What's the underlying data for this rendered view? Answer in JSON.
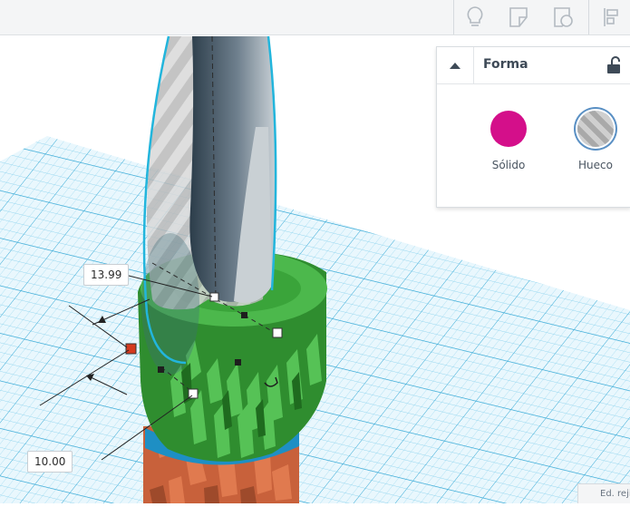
{
  "toolbar": {
    "buttons": [
      {
        "name": "lightbulb-icon"
      },
      {
        "name": "notes-icon"
      },
      {
        "name": "shape-notes-icon"
      },
      {
        "name": "align-icon"
      }
    ]
  },
  "shape_panel": {
    "title": "Forma",
    "options": [
      {
        "label": "Sólido",
        "color": "#d40f8a",
        "selected": true
      },
      {
        "label": "Hueco",
        "color": "#b8b8b8",
        "selected": false
      }
    ]
  },
  "dimensions": {
    "top_value": "13.99",
    "bottom_value": "10.00"
  },
  "footer": {
    "edit_grid_label": "Ed. rejilla"
  },
  "colors": {
    "grid": "#2fa9d7",
    "solid": "#d40f8a",
    "shape_green": "#2e8b2e",
    "selection": "#22b5dc"
  }
}
